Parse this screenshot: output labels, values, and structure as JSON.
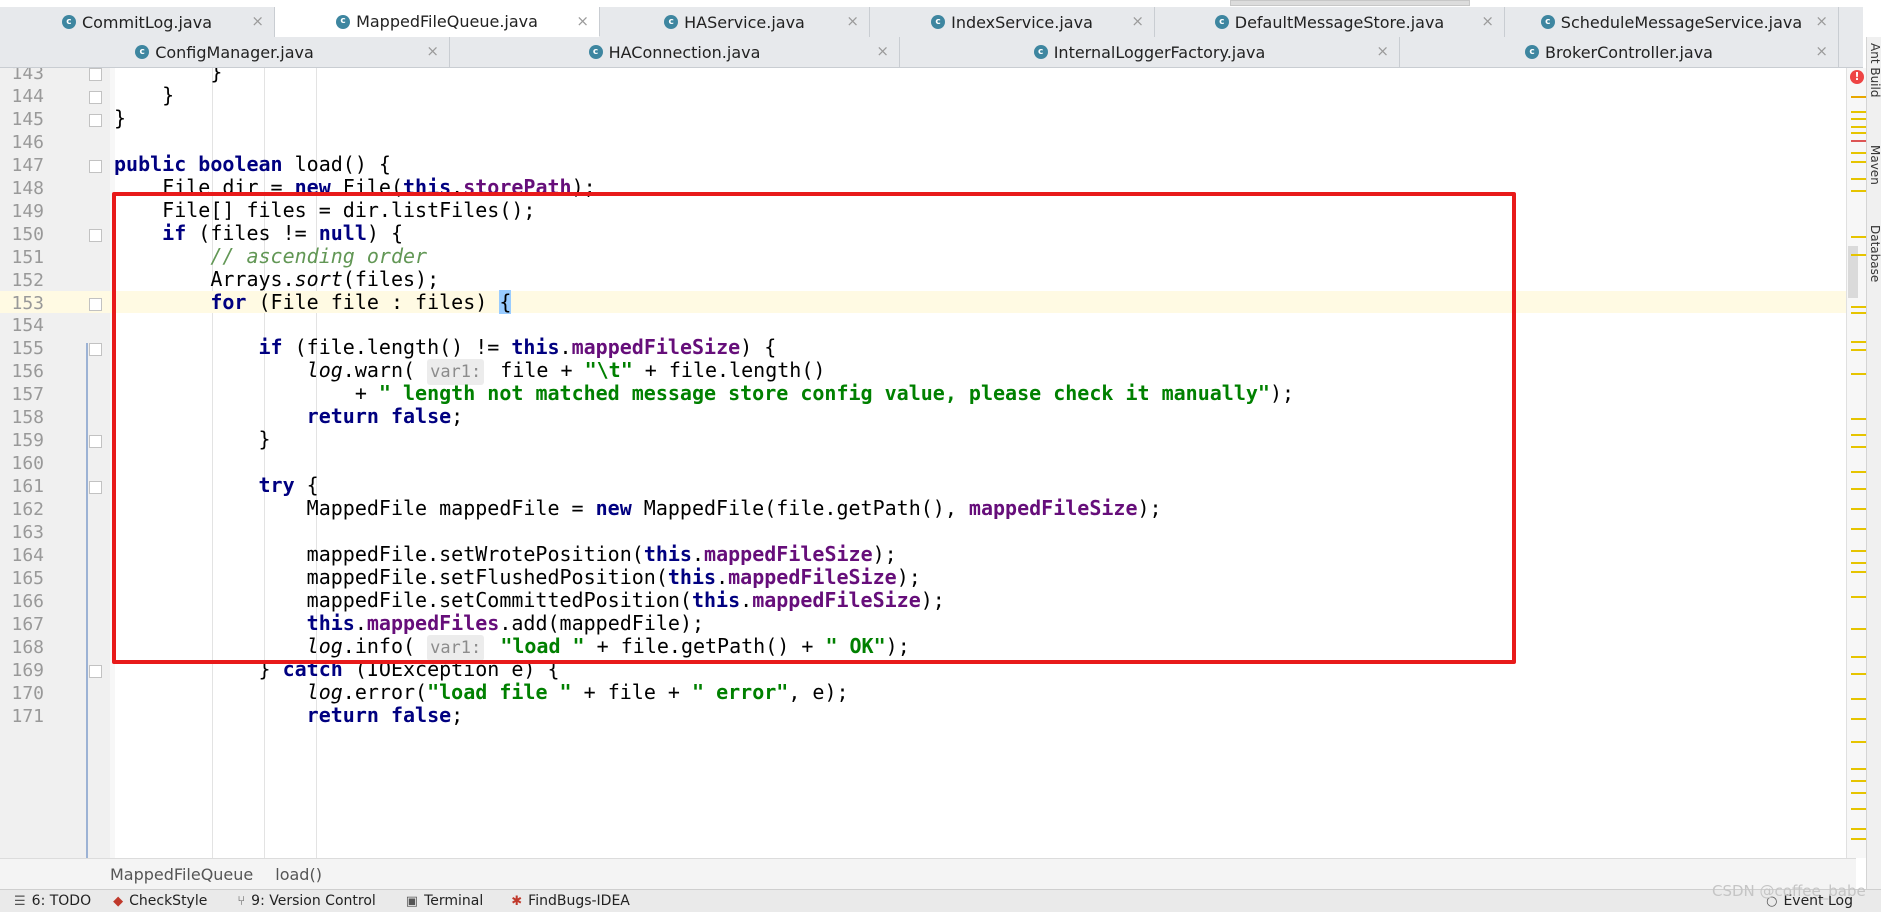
{
  "tabs_row1": [
    {
      "label": "CommitLog.java",
      "active": false
    },
    {
      "label": "MappedFileQueue.java",
      "active": true
    },
    {
      "label": "HAService.java",
      "active": false
    },
    {
      "label": "IndexService.java",
      "active": false
    },
    {
      "label": "DefaultMessageStore.java",
      "active": false
    },
    {
      "label": "ScheduleMessageService.java",
      "active": false
    }
  ],
  "tabs_row2": [
    {
      "label": "ConfigManager.java"
    },
    {
      "label": "HAConnection.java"
    },
    {
      "label": "InternalLoggerFactory.java"
    },
    {
      "label": "BrokerController.java"
    }
  ],
  "editor": {
    "current_line": 153,
    "lines": [
      {
        "n": 143,
        "code": "        }"
      },
      {
        "n": 144,
        "code": "    }"
      },
      {
        "n": 145,
        "code": "}"
      },
      {
        "n": 146,
        "code": ""
      },
      {
        "n": 147,
        "code": "public boolean load() {"
      },
      {
        "n": 148,
        "code": "    File dir = new File(this.storePath);"
      },
      {
        "n": 149,
        "code": "    File[] files = dir.listFiles();"
      },
      {
        "n": 150,
        "code": "    if (files != null) {"
      },
      {
        "n": 151,
        "code": "        // ascending order"
      },
      {
        "n": 152,
        "code": "        Arrays.sort(files);"
      },
      {
        "n": 153,
        "code": "        for (File file : files) {"
      },
      {
        "n": 154,
        "code": ""
      },
      {
        "n": 155,
        "code": "            if (file.length() != this.mappedFileSize) {"
      },
      {
        "n": 156,
        "code": "                log.warn( var1: file + \"\\t\" + file.length()"
      },
      {
        "n": 157,
        "code": "                    + \" length not matched message store config value, please check it manually\");"
      },
      {
        "n": 158,
        "code": "                return false;"
      },
      {
        "n": 159,
        "code": "            }"
      },
      {
        "n": 160,
        "code": ""
      },
      {
        "n": 161,
        "code": "            try {"
      },
      {
        "n": 162,
        "code": "                MappedFile mappedFile = new MappedFile(file.getPath(), mappedFileSize);"
      },
      {
        "n": 163,
        "code": ""
      },
      {
        "n": 164,
        "code": "                mappedFile.setWrotePosition(this.mappedFileSize);"
      },
      {
        "n": 165,
        "code": "                mappedFile.setFlushedPosition(this.mappedFileSize);"
      },
      {
        "n": 166,
        "code": "                mappedFile.setCommittedPosition(this.mappedFileSize);"
      },
      {
        "n": 167,
        "code": "                this.mappedFiles.add(mappedFile);"
      },
      {
        "n": 168,
        "code": "                log.info( var1: \"load \" + file.getPath() + \" OK\");"
      },
      {
        "n": 169,
        "code": "            } catch (IOException e) {"
      },
      {
        "n": 170,
        "code": "                log.error(\"load file \" + file + \" error\", e);"
      },
      {
        "n": 171,
        "code": "                return false;"
      }
    ]
  },
  "breadcrumb": {
    "items": [
      "MappedFileQueue",
      "load()"
    ]
  },
  "statusbar": {
    "items": [
      "6: TODO",
      "CheckStyle",
      "9: Version Control",
      "Terminal",
      "FindBugs-IDEA"
    ],
    "right": "Event Log"
  },
  "right_toolbar": {
    "items": [
      "Ant Build",
      "Maven",
      "Database"
    ]
  },
  "watermark": "CSDN @coffee_babe",
  "colors": {
    "highlight_box": "#e81a1a",
    "keyword": "#000080",
    "field": "#660e7a",
    "string": "#008000",
    "comment": "#629755"
  }
}
